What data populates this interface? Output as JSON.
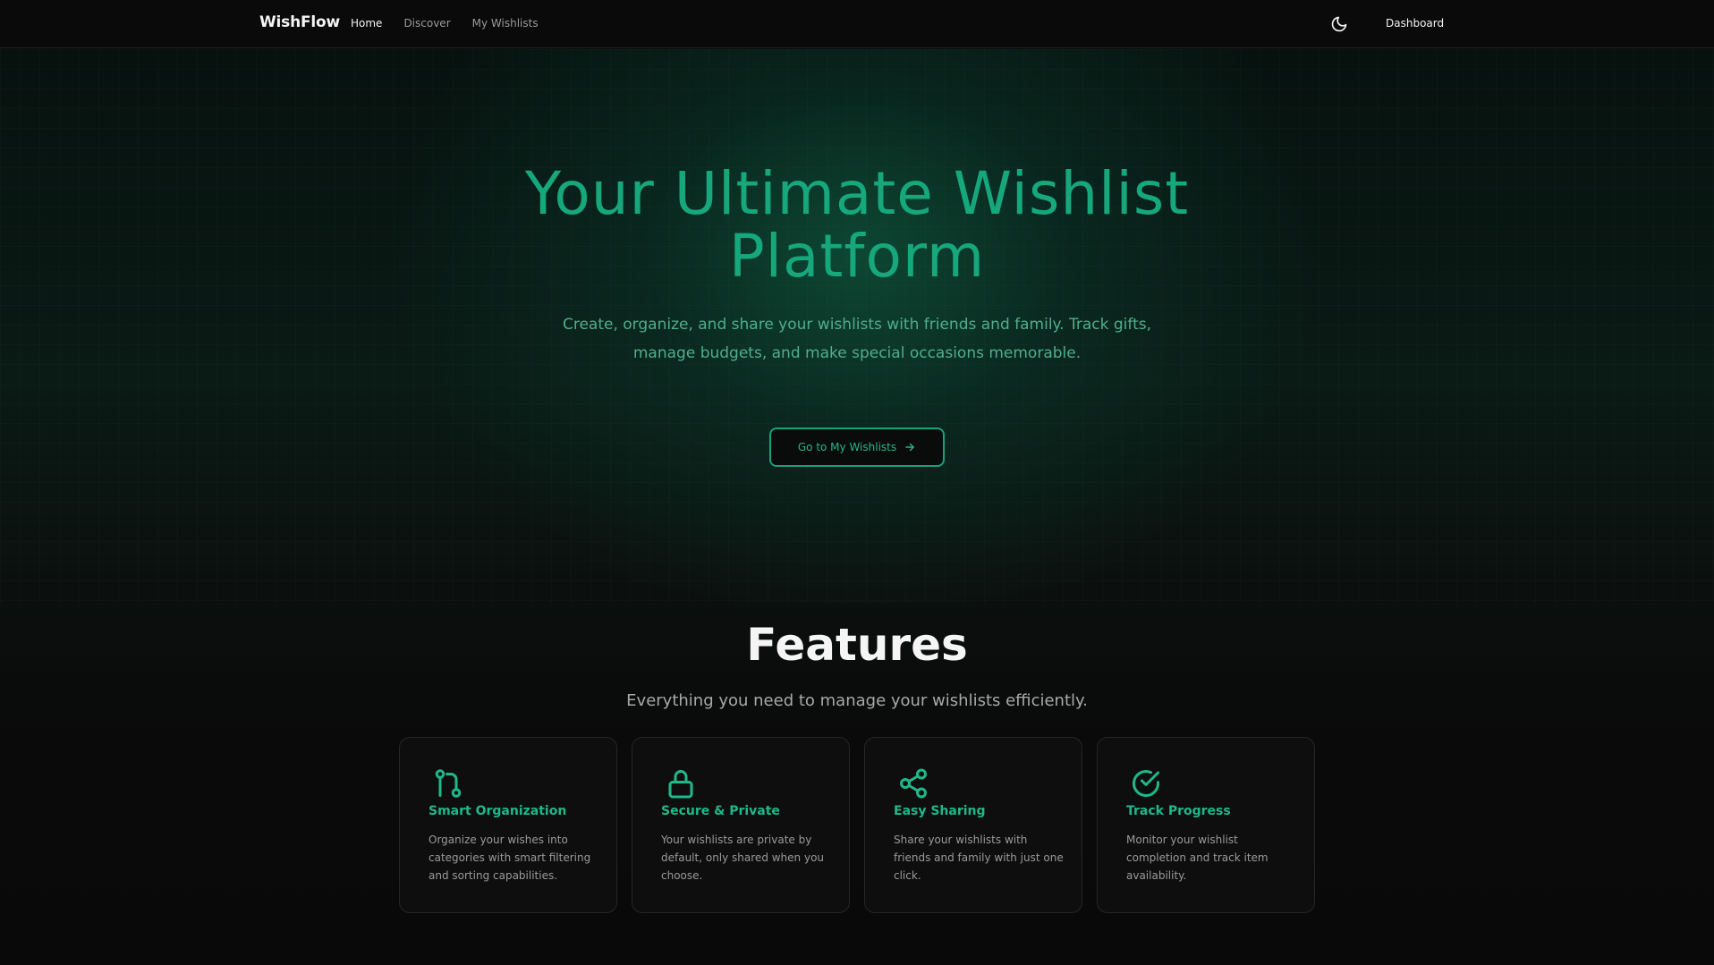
{
  "header": {
    "brand": "WishFlow",
    "nav": [
      {
        "label": "Home",
        "active": true
      },
      {
        "label": "Discover",
        "active": false
      },
      {
        "label": "My Wishlists",
        "active": false
      }
    ],
    "theme_icon": "moon-icon",
    "dashboard_label": "Dashboard"
  },
  "hero": {
    "title": "Your Ultimate Wishlist Platform",
    "subtitle": "Create, organize, and share your wishlists with friends and family. Track gifts, manage budgets, and make special occasions memorable.",
    "cta_label": "Go to My Wishlists",
    "cta_icon": "arrow-right-icon"
  },
  "features": {
    "title": "Features",
    "subtitle": "Everything you need to manage your wishlists efficiently.",
    "cards": [
      {
        "title": "Smart Organization",
        "description": "Organize your wishes into categories with smart filtering and sorting capabilities.",
        "icon": "git-pull-request-icon"
      },
      {
        "title": "Secure & Private",
        "description": "Your wishlists are private by default, only shared when you choose.",
        "icon": "lock-icon"
      },
      {
        "title": "Easy Sharing",
        "description": "Share your wishlists with friends and family with just one click.",
        "icon": "share-icon"
      },
      {
        "title": "Track Progress",
        "description": "Monitor your wishlist completion and track item availability.",
        "icon": "check-circle-icon"
      }
    ]
  },
  "colors": {
    "accent": "#16a77b",
    "background": "#0b0a0a",
    "card_border": "#262626"
  }
}
